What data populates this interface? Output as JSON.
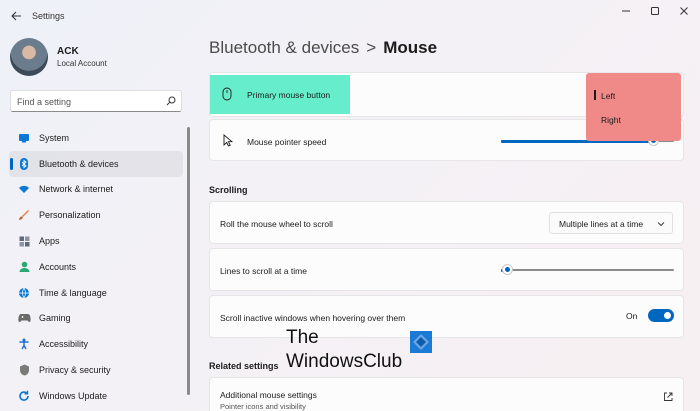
{
  "window": {
    "title": "Settings"
  },
  "profile": {
    "name": "ACK",
    "account_type": "Local Account"
  },
  "search": {
    "placeholder": "Find a setting"
  },
  "sidebar": {
    "items": [
      {
        "label": "System",
        "icon": "monitor-icon",
        "color": "#0a78d4"
      },
      {
        "label": "Bluetooth & devices",
        "icon": "bluetooth-icon",
        "color": "#0a78d4",
        "active": true
      },
      {
        "label": "Network & internet",
        "icon": "wifi-icon",
        "color": "#0a78d4"
      },
      {
        "label": "Personalization",
        "icon": "brush-icon",
        "color": "#e8824a"
      },
      {
        "label": "Apps",
        "icon": "apps-grid-icon",
        "color": "#5f6b7a"
      },
      {
        "label": "Accounts",
        "icon": "person-icon",
        "color": "#2aa872"
      },
      {
        "label": "Time & language",
        "icon": "globe-clock-icon",
        "color": "#0a78d4"
      },
      {
        "label": "Gaming",
        "icon": "gamepad-icon",
        "color": "#6b6b6b"
      },
      {
        "label": "Accessibility",
        "icon": "accessibility-icon",
        "color": "#1c6ed2"
      },
      {
        "label": "Privacy & security",
        "icon": "shield-icon",
        "color": "#7a7a7a"
      },
      {
        "label": "Windows Update",
        "icon": "refresh-icon",
        "color": "#0a78d4"
      }
    ]
  },
  "breadcrumb": {
    "parent": "Bluetooth & devices",
    "separator": ">",
    "current": "Mouse"
  },
  "settings": {
    "primary_button": {
      "label": "Primary mouse button",
      "options": [
        "Left",
        "Right"
      ],
      "selected": "Left"
    },
    "pointer_speed": {
      "label": "Mouse pointer speed",
      "value_fraction": 0.88
    },
    "scrolling_title": "Scrolling",
    "roll_wheel": {
      "label": "Roll the mouse wheel to scroll",
      "value": "Multiple lines at a time"
    },
    "lines_to_scroll": {
      "label": "Lines to scroll at a time",
      "value_fraction": 0.04
    },
    "inactive_scroll": {
      "label": "Scroll inactive windows when hovering over them",
      "state": "On"
    },
    "related_title": "Related settings",
    "additional": {
      "label": "Additional mouse settings",
      "sublabel": "Pointer icons and visibility"
    }
  },
  "watermark": {
    "line1": "The",
    "line2": "WindowsClub"
  },
  "colors": {
    "accent": "#0067c0",
    "highlight_cyan": "#66eecc",
    "highlight_red": "#f08a88"
  }
}
